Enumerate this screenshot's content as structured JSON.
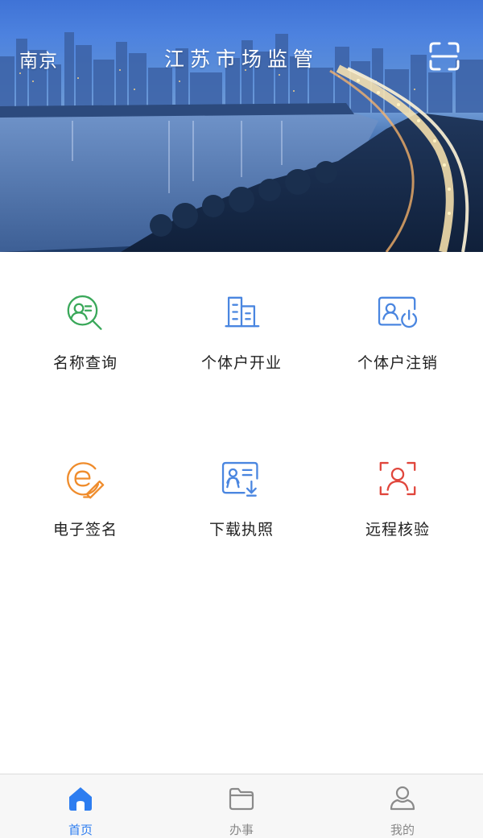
{
  "header": {
    "city": "南京",
    "title": "江苏市场监管",
    "scan_icon": "scan-icon"
  },
  "services": [
    {
      "label": "名称查询",
      "icon": "name-search-icon",
      "color": "#3aa85a"
    },
    {
      "label": "个体户开业",
      "icon": "building-icon",
      "color": "#4a86e0"
    },
    {
      "label": "个体户注销",
      "icon": "deregister-icon",
      "color": "#4a86e0"
    },
    {
      "label": "电子签名",
      "icon": "e-signature-icon",
      "color": "#ef8c2c"
    },
    {
      "label": "下载执照",
      "icon": "license-download-icon",
      "color": "#4a86e0"
    },
    {
      "label": "远程核验",
      "icon": "remote-verify-icon",
      "color": "#e0463c"
    }
  ],
  "tabbar": {
    "items": [
      {
        "label": "首页",
        "icon": "home-icon",
        "active": true
      },
      {
        "label": "办事",
        "icon": "folder-icon",
        "active": false
      },
      {
        "label": "我的",
        "icon": "user-icon",
        "active": false
      }
    ],
    "active_color": "#2d7df0",
    "inactive_color": "#888888"
  }
}
